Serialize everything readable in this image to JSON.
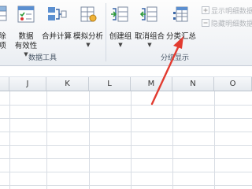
{
  "ribbon": {
    "buttons": {
      "delete_fragment_top": "除",
      "delete_fragment_bottom": "项",
      "data_validity_top": "数据",
      "data_validity_bottom": "有效性",
      "consolidate": "合并计算",
      "what_if": "模拟分析",
      "group": "创建组",
      "ungroup": "取消组合",
      "subtotal": "分类汇总",
      "show_detail": "显示明细数据",
      "hide_detail": "隐藏明细数据"
    },
    "groups": {
      "data_tools": "数据工具",
      "outline": "分级显示"
    }
  },
  "sheet": {
    "columns": [
      "J",
      "K",
      "L",
      "M",
      "N",
      "O"
    ]
  },
  "colors": {
    "annotation_arrow": "#e23b30",
    "ribbon_bg": "#f1f3f6",
    "gridline": "#d8dde4"
  },
  "icons": [
    "table-icon",
    "checklist-icon",
    "consolidate-icon",
    "what-if-icon",
    "group-icon",
    "ungroup-icon",
    "subtotal-icon",
    "plus-detail-icon",
    "minus-detail-icon"
  ]
}
